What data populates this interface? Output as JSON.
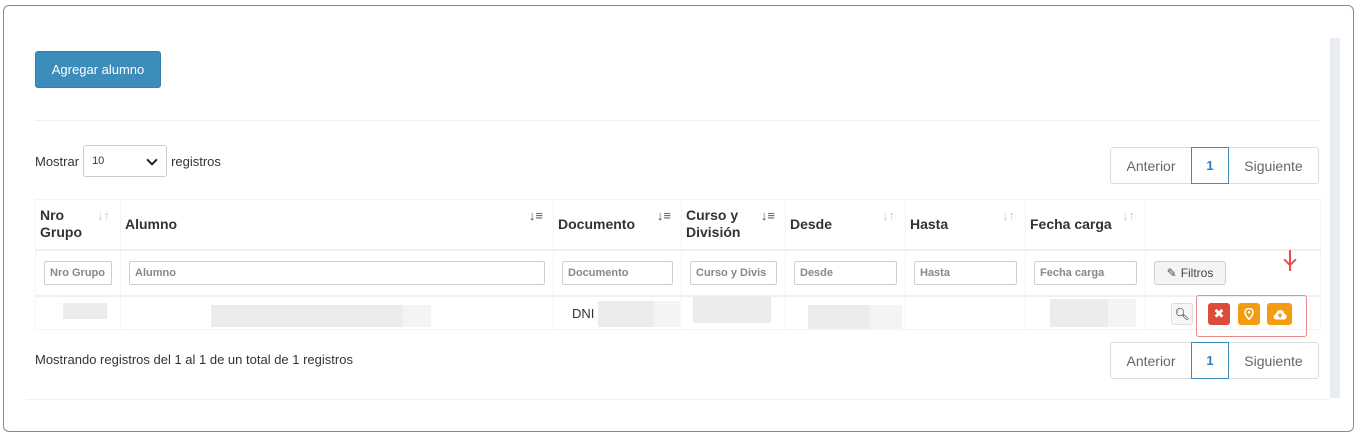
{
  "toolbar": {
    "add_label": "Agregar alumno"
  },
  "length_menu": {
    "prefix": "Mostrar",
    "value": "10",
    "suffix": "registros"
  },
  "pagination": {
    "prev": "Anterior",
    "current": "1",
    "next": "Siguiente"
  },
  "table": {
    "columns": [
      {
        "label": "Nro Grupo",
        "placeholder": "Nro Grupo"
      },
      {
        "label": "Alumno",
        "placeholder": "Alumno"
      },
      {
        "label": "Documento",
        "placeholder": "Documento"
      },
      {
        "label": "Curso y División",
        "placeholder": "Curso y Divis"
      },
      {
        "label": "Desde",
        "placeholder": "Desde"
      },
      {
        "label": "Hasta",
        "placeholder": "Hasta"
      },
      {
        "label": "Fecha carga",
        "placeholder": "Fecha carga"
      }
    ],
    "filter_button": "Filtros",
    "row": {
      "documento_prefix": "DNI"
    }
  },
  "icons": {
    "search": "search-icon",
    "delete": "times-icon",
    "location": "map-marker-icon",
    "upload": "cloud-upload-icon",
    "eraser": "eraser-icon"
  },
  "colors": {
    "primary": "#3c8dbc",
    "danger": "#dd4b39",
    "warning": "#f39c12",
    "annotation": "#e05050"
  },
  "footer": {
    "info": "Mostrando registros del 1 al 1 de un total de 1 registros"
  }
}
